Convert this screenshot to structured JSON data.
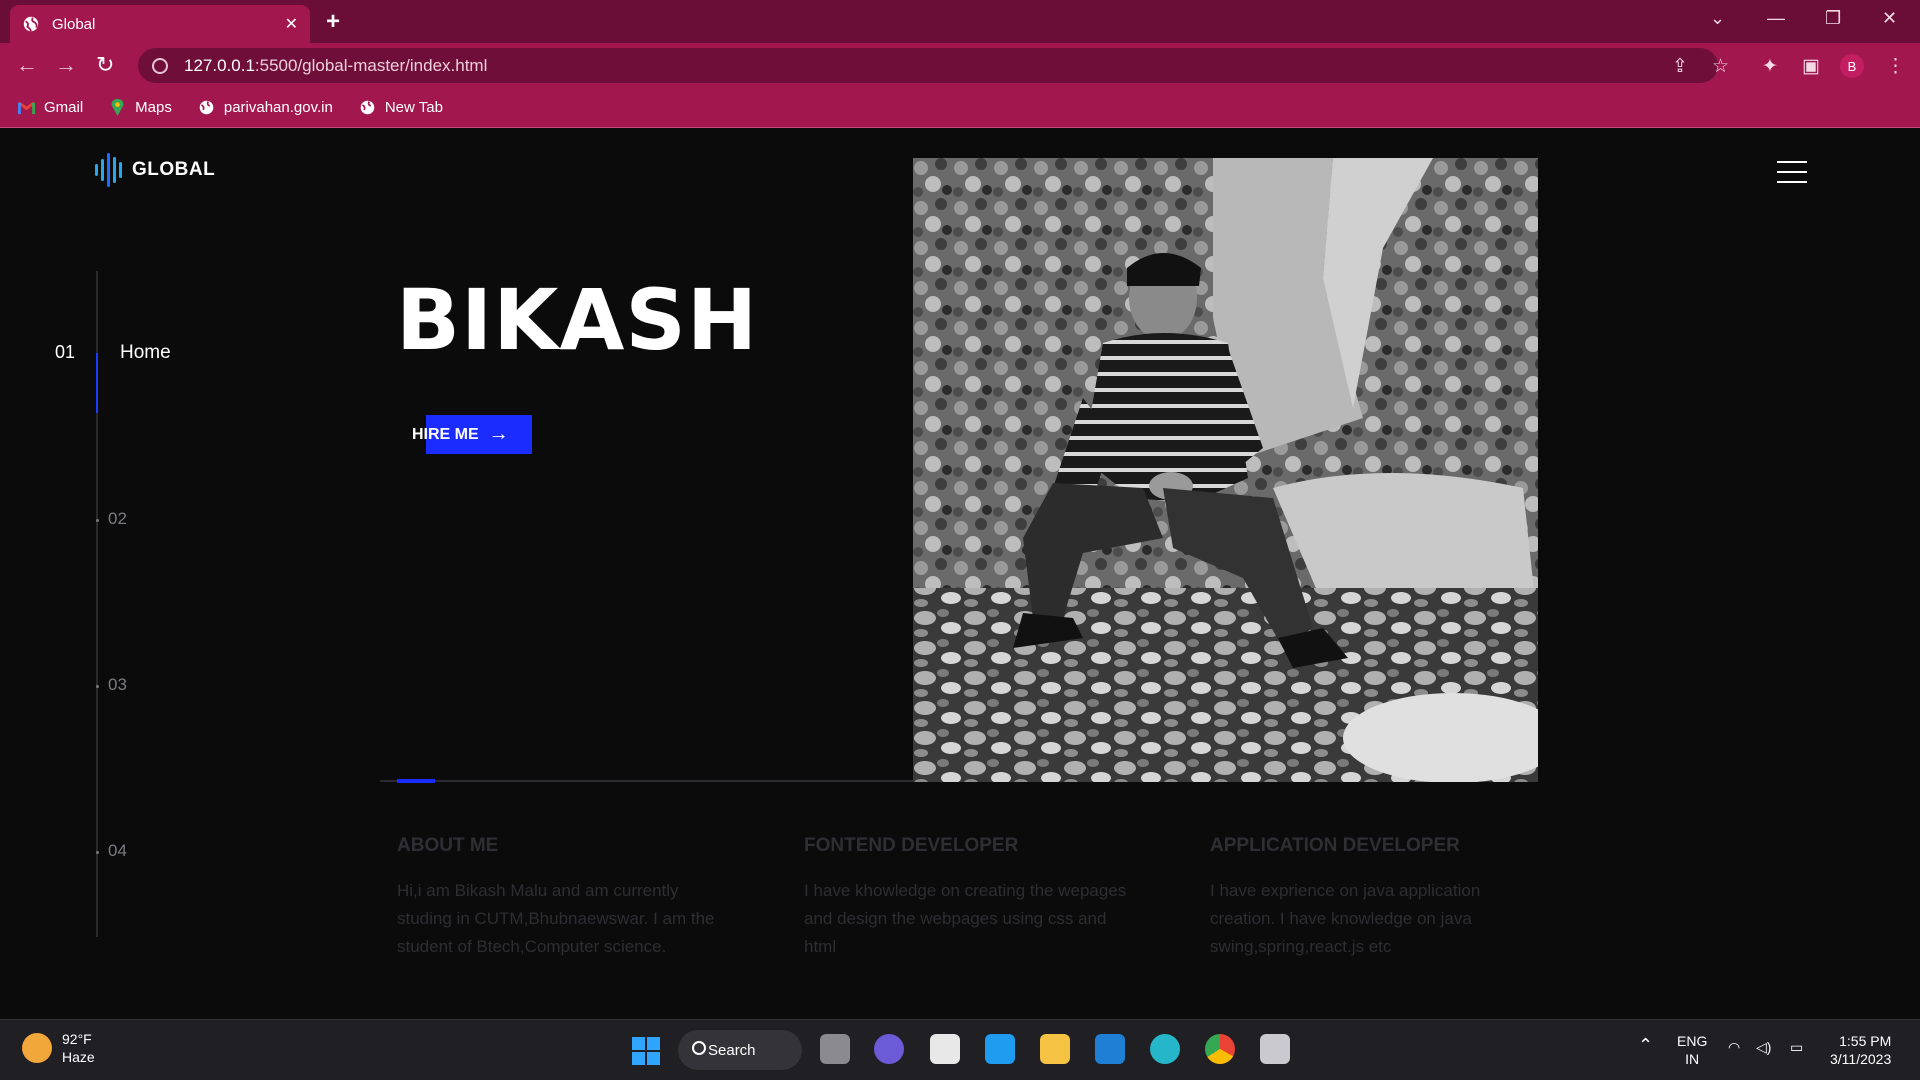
{
  "browser": {
    "tab_title": "Global",
    "url_host": "127.0.0.1",
    "url_path": ":5500/global-master/index.html",
    "bookmarks": [
      "Gmail",
      "Maps",
      "parivahan.gov.in",
      "New Tab"
    ],
    "profile_initial": "B"
  },
  "site": {
    "logo_text": "GLOBAL",
    "nav": {
      "active_number": "01",
      "active_label": "Home",
      "pages": [
        "02",
        "03",
        "04"
      ]
    },
    "hero": {
      "title": "BIKASH",
      "cta": "HIRE ME"
    },
    "sections": [
      {
        "title": "ABOUT ME",
        "text": "Hi,i am Bikash Malu and am currently studing in CUTM,Bhubnaewswar. I am the student of Btech,Computer science."
      },
      {
        "title": "FONTEND DEVELOPER",
        "text": "I have khowledge on creating the wepages and design the webpages using css and html"
      },
      {
        "title": "APPLICATION DEVELOPER",
        "text": "I have exprience on java application creation. I have knowledge on java swing,spring,react.js etc"
      }
    ],
    "progress": 0.07
  },
  "taskbar": {
    "weather_temp": "92°F",
    "weather_desc": "Haze",
    "search_label": "Search",
    "lang_top": "ENG",
    "lang_bottom": "IN",
    "time": "1:55 PM",
    "date": "3/11/2023"
  }
}
